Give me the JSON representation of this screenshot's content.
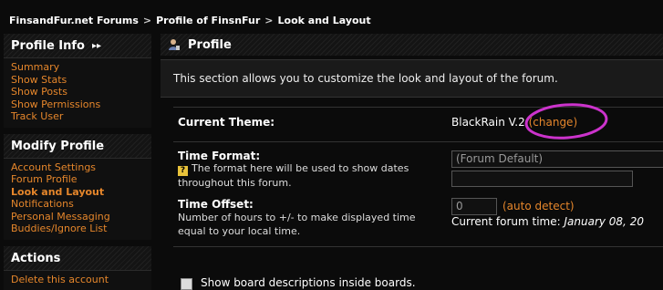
{
  "breadcrumb": {
    "items": [
      "FinsandFur.net Forums",
      "Profile of FinsnFur",
      "Look and Layout"
    ],
    "separator": ">"
  },
  "sidebar": {
    "sections": [
      {
        "title": "Profile Info",
        "items": [
          "Summary",
          "Show Stats",
          "Show Posts",
          "Show Permissions",
          "Track User"
        ]
      },
      {
        "title": "Modify Profile",
        "items": [
          "Account Settings",
          "Forum Profile",
          "Look and Layout",
          "Notifications",
          "Personal Messaging",
          "Buddies/Ignore List"
        ],
        "active": "Look and Layout"
      },
      {
        "title": "Actions",
        "items": [
          "Delete this account"
        ]
      }
    ]
  },
  "main": {
    "title": "Profile",
    "intro": "This section allows you to customize the look and layout of the forum.",
    "current_theme": {
      "label": "Current Theme:",
      "value": "BlackRain V.2",
      "change_link": "(change)"
    },
    "time_format": {
      "label": "Time Format:",
      "description": "The format here will be used to show dates throughout this forum.",
      "select_value": "(Forum Default)"
    },
    "time_offset": {
      "label": "Time Offset:",
      "description": "Number of hours to +/- to make displayed time equal to your local time.",
      "value": "0",
      "auto_detect": "(auto detect)",
      "current_time_label": "Current forum time:",
      "current_time_value": "January 08, 20"
    },
    "checkbox_label": "Show board descriptions inside boards."
  },
  "colors": {
    "accent": "#e5862b",
    "highlight_circle": "#cc33cc",
    "background": "#0b0b0b"
  }
}
